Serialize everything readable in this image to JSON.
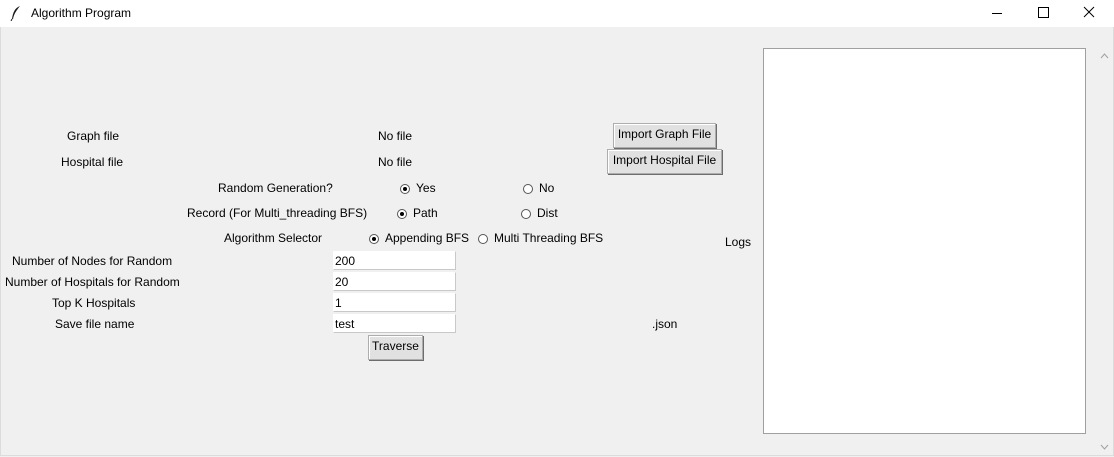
{
  "window": {
    "title": "Algorithm Program",
    "app_icon": "feather-icon"
  },
  "graph_file": {
    "label": "Graph file",
    "status": "No file",
    "button": "Import Graph File"
  },
  "hospital_file": {
    "label": "Hospital file",
    "status": "No file",
    "button": "Import Hospital File"
  },
  "random_generation": {
    "label": "Random Generation?",
    "options": [
      "Yes",
      "No"
    ],
    "selected": "Yes"
  },
  "record": {
    "label": "Record (For Multi_threading BFS)",
    "options": [
      "Path",
      "Dist"
    ],
    "selected": "Path"
  },
  "algorithm": {
    "label": "Algorithm Selector",
    "options": [
      "Appending BFS",
      "Multi Threading BFS"
    ],
    "selected": "Appending BFS"
  },
  "nodes": {
    "label": "Number of Nodes for Random",
    "value": "200"
  },
  "hospitals": {
    "label": "Number of Hospitals for Random",
    "value": "20"
  },
  "top_k": {
    "label": "Top K Hospitals",
    "value": "1"
  },
  "save_file": {
    "label": "Save file name",
    "value": "test",
    "suffix": ".json"
  },
  "traverse_button": "Traverse",
  "logs_label": "Logs"
}
